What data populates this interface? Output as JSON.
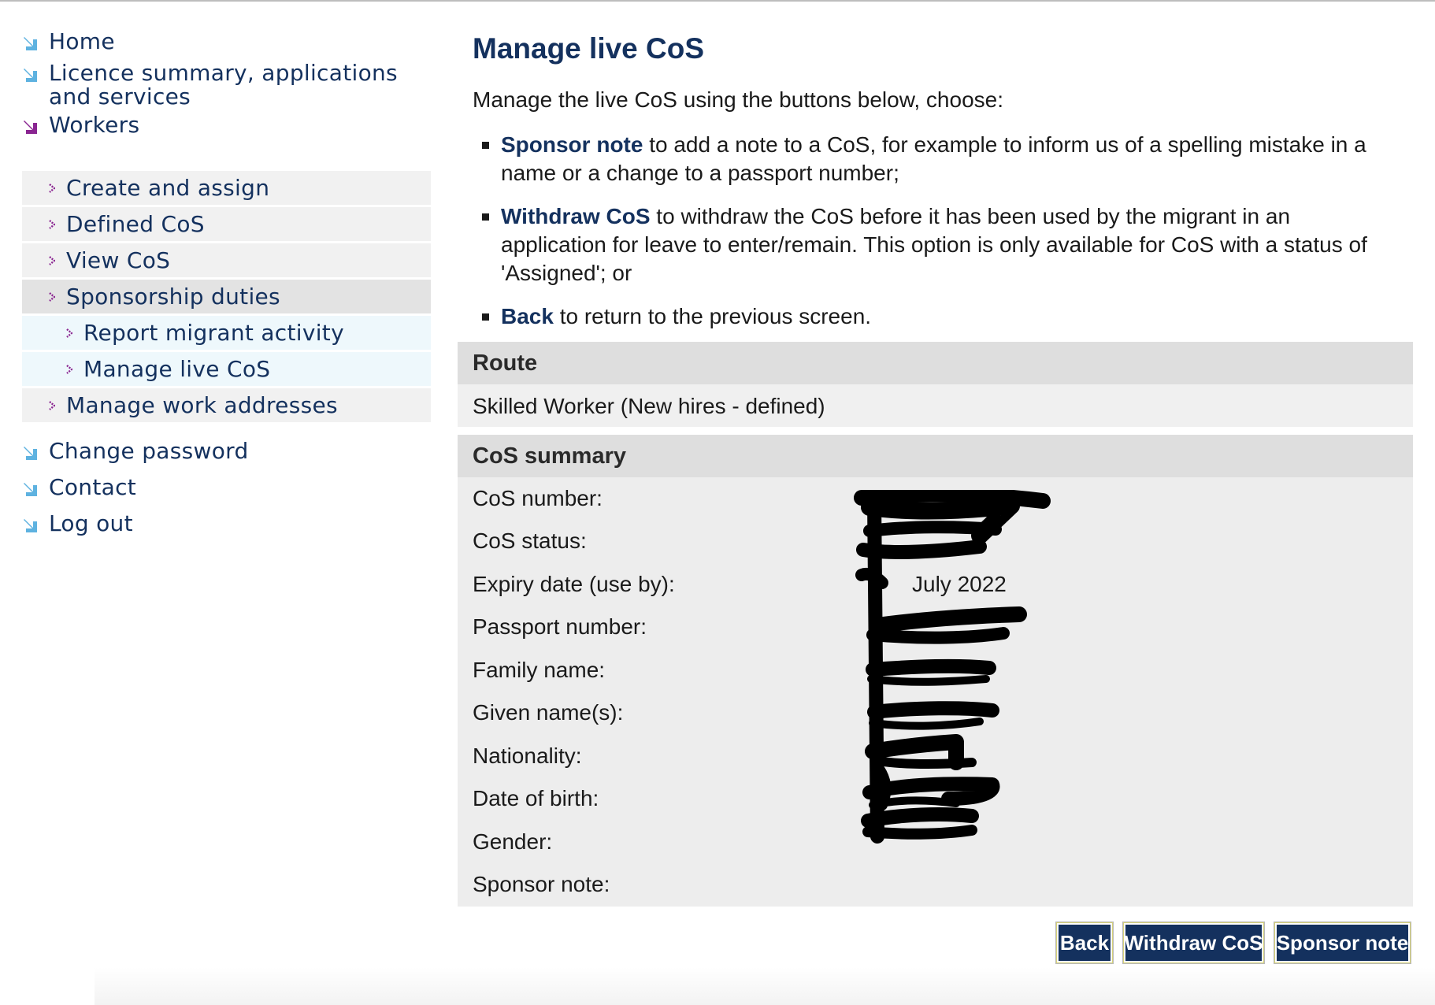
{
  "nav": {
    "top_items": [
      {
        "label": "Home"
      },
      {
        "label": "Licence summary, applications"
      },
      {
        "label": "and services"
      },
      {
        "label": "Workers"
      },
      {
        "label": "Change password"
      },
      {
        "label": "Contact"
      },
      {
        "label": "Log out"
      }
    ],
    "sub_items": [
      {
        "label": "Create and assign"
      },
      {
        "label": "Defined CoS"
      },
      {
        "label": "View CoS"
      },
      {
        "label": "Sponsorship duties"
      },
      {
        "label": "Report migrant activity"
      },
      {
        "label": "Manage live CoS"
      },
      {
        "label": "Manage work addresses"
      }
    ],
    "arrow_color": "#5eb2e0",
    "active_arrow_color": "#8a2591",
    "chevron_color": "#8a2591"
  },
  "main": {
    "title": "Manage live CoS",
    "intro": "Manage the live CoS using the buttons below, choose:",
    "bullets": [
      {
        "keyword": "Sponsor note",
        "text": " to add a note to a CoS, for example to inform us of a spelling mistake in a name or a change to a passport number;"
      },
      {
        "keyword": "Withdraw CoS",
        "text": " to withdraw the CoS before it has been used by the migrant in an application for leave to enter/remain. This option is only available for CoS with a status of 'Assigned'; or"
      },
      {
        "keyword": "Back",
        "text": " to return to the previous screen."
      }
    ],
    "route": {
      "heading": "Route",
      "value": "Skilled Worker (New hires - defined)"
    },
    "summary": {
      "heading": "CoS summary",
      "rows": [
        {
          "label": "CoS number:",
          "value": ""
        },
        {
          "label": "CoS status:",
          "value": ""
        },
        {
          "label": "Expiry date (use by):",
          "value": "July 2022"
        },
        {
          "label": "Passport number:",
          "value": ""
        },
        {
          "label": "Family name:",
          "value": ""
        },
        {
          "label": "Given name(s):",
          "value": ""
        },
        {
          "label": "Nationality:",
          "value": ""
        },
        {
          "label": "Date of birth:",
          "value": ""
        },
        {
          "label": "Gender:",
          "value": ""
        },
        {
          "label": "Sponsor note:",
          "value": ""
        }
      ]
    },
    "buttons": {
      "back": "Back",
      "withdraw": "Withdraw CoS",
      "sponsor_note": "Sponsor note"
    }
  },
  "colors": {
    "brand_navy": "#14315e",
    "section_header_bg": "#dedede",
    "section_body_bg": "#ededed"
  }
}
